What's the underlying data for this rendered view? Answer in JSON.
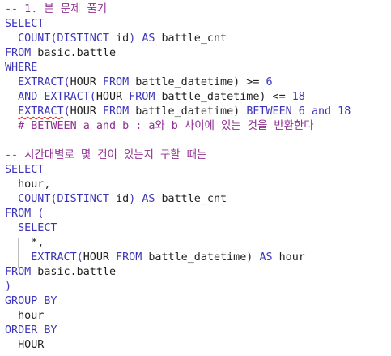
{
  "editor": {
    "lines": [
      [
        {
          "t": "-- 1. 본 문제 풀기",
          "c": "cmt"
        }
      ],
      [
        {
          "t": "SELECT",
          "c": "kw"
        }
      ],
      [
        {
          "t": "  COUNT(DISTINCT ",
          "c": "kw"
        },
        {
          "t": "id",
          "c": "txt"
        },
        {
          "t": ") ",
          "c": "kw"
        },
        {
          "t": "AS",
          "c": "kw"
        },
        {
          "t": " battle_cnt",
          "c": "txt"
        }
      ],
      [
        {
          "t": "FROM",
          "c": "kw"
        },
        {
          "t": " basic.battle",
          "c": "txt"
        }
      ],
      [
        {
          "t": "WHERE",
          "c": "kw"
        }
      ],
      [
        {
          "t": "  EXTRACT(",
          "c": "kw"
        },
        {
          "t": "HOUR",
          "c": "txt"
        },
        {
          "t": " FROM ",
          "c": "kw"
        },
        {
          "t": "battle_datetime) >= ",
          "c": "txt"
        },
        {
          "t": "6",
          "c": "num"
        }
      ],
      [
        {
          "t": "  AND EXTRACT(",
          "c": "kw"
        },
        {
          "t": "HOUR",
          "c": "txt"
        },
        {
          "t": " FROM ",
          "c": "kw"
        },
        {
          "t": "battle_datetime) <= ",
          "c": "txt"
        },
        {
          "t": "18",
          "c": "num"
        }
      ],
      [
        {
          "t": "  ",
          "c": "txt"
        },
        {
          "t": "EXTRACT",
          "c": "kw",
          "sq": true
        },
        {
          "t": "(",
          "c": "kw"
        },
        {
          "t": "HOUR",
          "c": "txt"
        },
        {
          "t": " FROM ",
          "c": "kw"
        },
        {
          "t": "battle_datetime) ",
          "c": "txt"
        },
        {
          "t": "BETWEEN",
          "c": "kw"
        },
        {
          "t": " 6 ",
          "c": "num"
        },
        {
          "t": "and",
          "c": "kw"
        },
        {
          "t": " 18",
          "c": "num"
        }
      ],
      [
        {
          "t": "  # BETWEEN a and b : a와 b 사이에 있는 것을 반환한다",
          "c": "cmt"
        }
      ],
      [
        {
          "t": "",
          "c": "txt"
        }
      ],
      [
        {
          "t": "-- 시간대별로 몇 건이 있는지 구할 때는",
          "c": "cmt"
        }
      ],
      [
        {
          "t": "SELECT",
          "c": "kw"
        }
      ],
      [
        {
          "t": "  hour,",
          "c": "txt"
        }
      ],
      [
        {
          "t": "  COUNT(DISTINCT ",
          "c": "kw"
        },
        {
          "t": "id",
          "c": "txt"
        },
        {
          "t": ") ",
          "c": "kw"
        },
        {
          "t": "AS",
          "c": "kw"
        },
        {
          "t": " battle_cnt",
          "c": "txt"
        }
      ],
      [
        {
          "t": "FROM (",
          "c": "kw"
        }
      ],
      [
        {
          "t": "  SELECT",
          "c": "kw"
        }
      ],
      [
        {
          "t": "    *,",
          "c": "txt"
        }
      ],
      [
        {
          "t": "    EXTRACT(",
          "c": "kw"
        },
        {
          "t": "HOUR",
          "c": "txt"
        },
        {
          "t": " FROM ",
          "c": "kw"
        },
        {
          "t": "battle_datetime) ",
          "c": "txt"
        },
        {
          "t": "AS",
          "c": "kw"
        },
        {
          "t": " hour",
          "c": "txt"
        }
      ],
      [
        {
          "t": "FROM",
          "c": "kw"
        },
        {
          "t": " basic.battle",
          "c": "txt"
        }
      ],
      [
        {
          "t": ")",
          "c": "kw"
        }
      ],
      [
        {
          "t": "GROUP BY",
          "c": "kw"
        }
      ],
      [
        {
          "t": "  hour",
          "c": "txt"
        }
      ],
      [
        {
          "t": "ORDER BY",
          "c": "kw"
        }
      ],
      [
        {
          "t": "  HOUR",
          "c": "txt"
        }
      ]
    ],
    "colors": {
      "keyword": "#3b34b9",
      "comment": "#8f2f8f",
      "text": "#1f1f1f",
      "error_underline": "#e0201e"
    }
  }
}
